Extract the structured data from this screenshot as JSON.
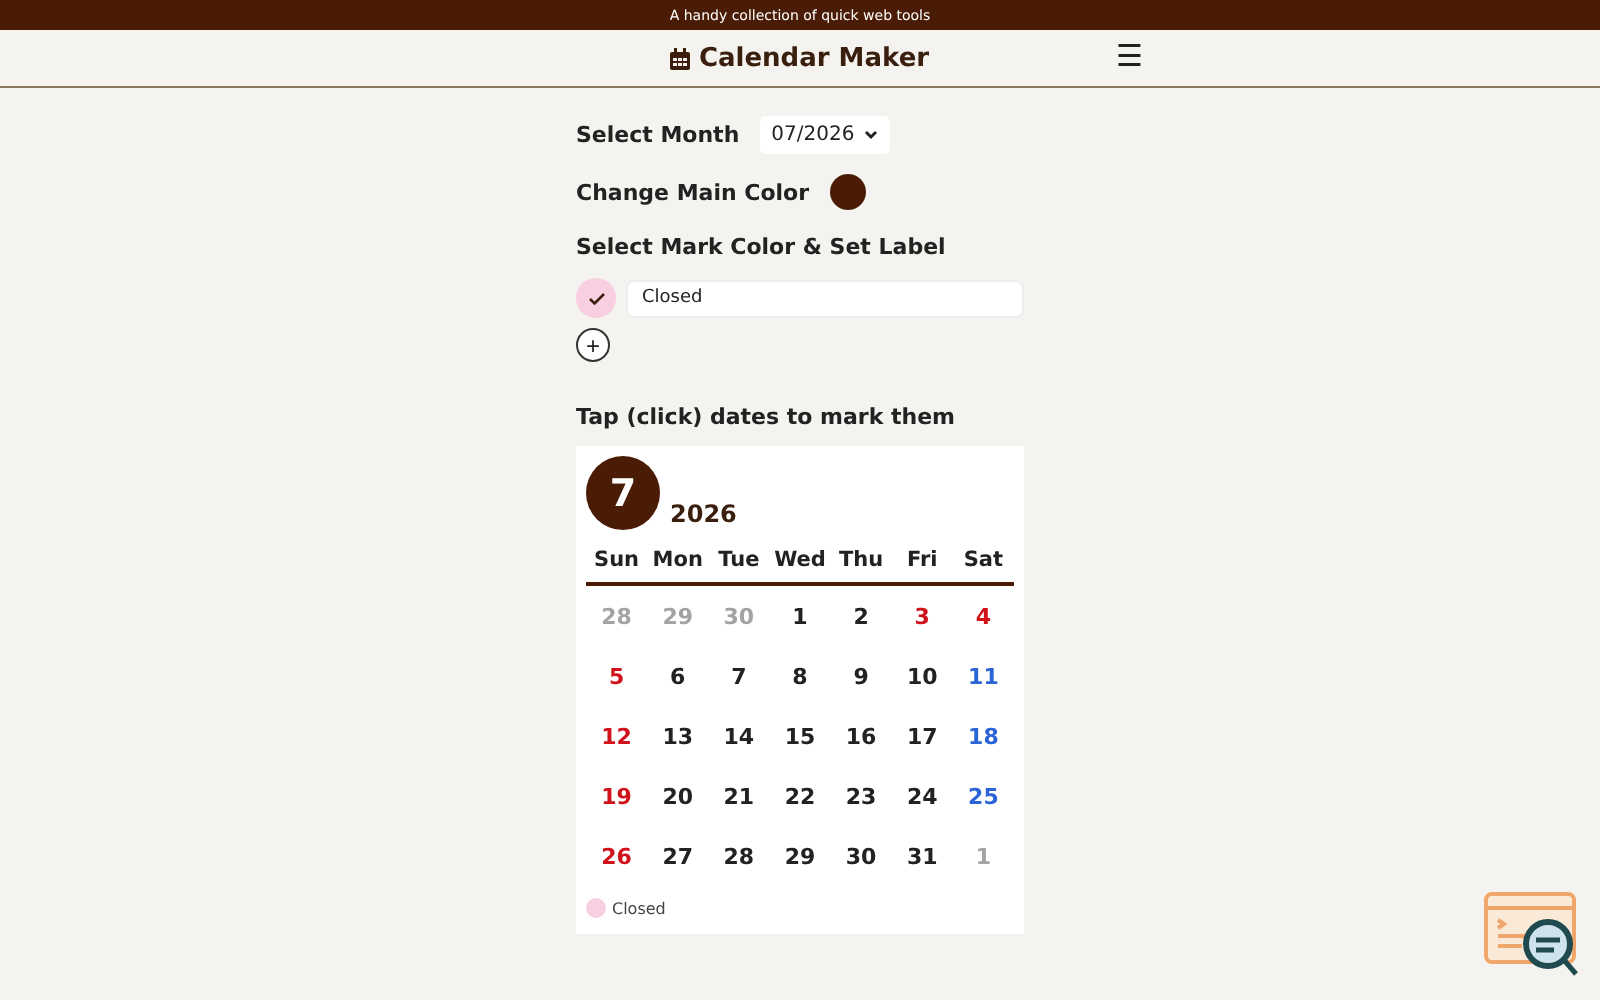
{
  "top_banner": "A handy collection of quick web tools",
  "header": {
    "title": "Calendar Maker",
    "menu_icon": "☰"
  },
  "month_select": {
    "label": "Select Month",
    "value": "07/2026"
  },
  "main_color": {
    "label": "Change Main Color",
    "color": "#4a1c05"
  },
  "marks": {
    "label": "Select Mark Color & Set Label",
    "items": [
      {
        "color": "#f8cfe0",
        "selected": true,
        "value": "Closed"
      }
    ],
    "add": "+"
  },
  "calendar": {
    "instruction": "Tap (click) dates to mark them",
    "month": "7",
    "year": "2026",
    "weekdays": [
      "Sun",
      "Mon",
      "Tue",
      "Wed",
      "Thu",
      "Fri",
      "Sat"
    ],
    "weeks": [
      [
        {
          "day": "28",
          "kind": "muted"
        },
        {
          "day": "29",
          "kind": "muted"
        },
        {
          "day": "30",
          "kind": "muted"
        },
        {
          "day": "1",
          "kind": "weekday"
        },
        {
          "day": "2",
          "kind": "weekday"
        },
        {
          "day": "3",
          "kind": "holiday"
        },
        {
          "day": "4",
          "kind": "holiday"
        }
      ],
      [
        {
          "day": "5",
          "kind": "holiday"
        },
        {
          "day": "6",
          "kind": "weekday"
        },
        {
          "day": "7",
          "kind": "weekday"
        },
        {
          "day": "8",
          "kind": "weekday"
        },
        {
          "day": "9",
          "kind": "weekday"
        },
        {
          "day": "10",
          "kind": "weekday"
        },
        {
          "day": "11",
          "kind": "saturday"
        }
      ],
      [
        {
          "day": "12",
          "kind": "holiday"
        },
        {
          "day": "13",
          "kind": "weekday"
        },
        {
          "day": "14",
          "kind": "weekday"
        },
        {
          "day": "15",
          "kind": "weekday"
        },
        {
          "day": "16",
          "kind": "weekday"
        },
        {
          "day": "17",
          "kind": "weekday"
        },
        {
          "day": "18",
          "kind": "saturday"
        }
      ],
      [
        {
          "day": "19",
          "kind": "holiday"
        },
        {
          "day": "20",
          "kind": "weekday"
        },
        {
          "day": "21",
          "kind": "weekday"
        },
        {
          "day": "22",
          "kind": "weekday"
        },
        {
          "day": "23",
          "kind": "weekday"
        },
        {
          "day": "24",
          "kind": "weekday"
        },
        {
          "day": "25",
          "kind": "saturday"
        }
      ],
      [
        {
          "day": "26",
          "kind": "holiday"
        },
        {
          "day": "27",
          "kind": "weekday"
        },
        {
          "day": "28",
          "kind": "weekday"
        },
        {
          "day": "29",
          "kind": "weekday"
        },
        {
          "day": "30",
          "kind": "weekday"
        },
        {
          "day": "31",
          "kind": "weekday"
        },
        {
          "day": "1",
          "kind": "muted"
        }
      ]
    ],
    "legend": [
      {
        "color": "#f8cfe0",
        "label": "Closed"
      }
    ]
  }
}
